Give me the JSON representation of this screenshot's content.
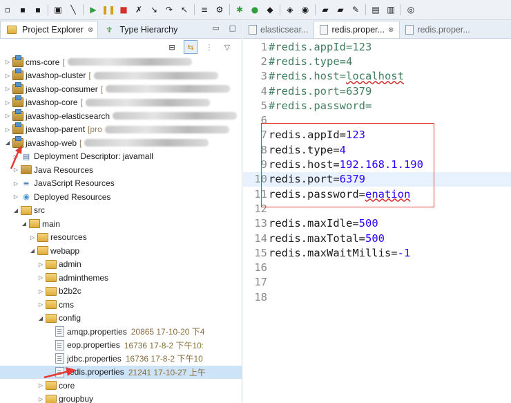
{
  "left_panel": {
    "tabs": [
      {
        "label": "Project Explorer",
        "close": "⊗",
        "icon": "project-explorer-icon"
      },
      {
        "label": "Type Hierarchy",
        "icon": "type-hierarchy-icon"
      }
    ],
    "tree": [
      {
        "label": "cms-core",
        "suffix": "[",
        "level": 0,
        "type": "project",
        "expanded": false
      },
      {
        "label": "javashop-cluster",
        "suffix": "[",
        "level": 0,
        "type": "project",
        "expanded": false
      },
      {
        "label": "javashop-consumer",
        "suffix": "[",
        "level": 0,
        "type": "project",
        "expanded": false
      },
      {
        "label": "javashop-core",
        "suffix": "[",
        "level": 0,
        "type": "project",
        "expanded": false
      },
      {
        "label": "javashop-elasticsearch",
        "suffix": "",
        "level": 0,
        "type": "project",
        "expanded": false
      },
      {
        "label": "javashop-parent",
        "suffix": "[pro",
        "level": 0,
        "type": "project",
        "expanded": false
      },
      {
        "label": "javashop-web",
        "suffix": "[",
        "level": 0,
        "type": "project",
        "expanded": true
      },
      {
        "label": "Deployment Descriptor: javamall",
        "level": 1,
        "type": "descriptor",
        "expanded": false
      },
      {
        "label": "Java Resources",
        "level": 1,
        "type": "java",
        "expanded": false
      },
      {
        "label": "JavaScript Resources",
        "level": 1,
        "type": "js",
        "expanded": false
      },
      {
        "label": "Deployed Resources",
        "level": 1,
        "type": "deployed",
        "expanded": false
      },
      {
        "label": "src",
        "level": 1,
        "type": "folder",
        "expanded": true
      },
      {
        "label": "main",
        "level": 2,
        "type": "folder",
        "expanded": true
      },
      {
        "label": "resources",
        "level": 3,
        "type": "folder",
        "expanded": false
      },
      {
        "label": "webapp",
        "level": 3,
        "type": "folder",
        "expanded": true
      },
      {
        "label": "admin",
        "level": 4,
        "type": "folder",
        "expanded": false
      },
      {
        "label": "adminthemes",
        "level": 4,
        "type": "folder",
        "expanded": false
      },
      {
        "label": "b2b2c",
        "level": 4,
        "type": "folder",
        "expanded": false
      },
      {
        "label": "cms",
        "level": 4,
        "type": "folder",
        "expanded": false
      },
      {
        "label": "config",
        "level": 4,
        "type": "folder",
        "expanded": true
      },
      {
        "label": "amqp.properties",
        "meta": "20865  17-10-20 下4",
        "level": 5,
        "type": "file"
      },
      {
        "label": "eop.properties",
        "meta": "16736  17-8-2 下午10:",
        "level": 5,
        "type": "file"
      },
      {
        "label": "jdbc.properties",
        "meta": "16736  17-8-2 下午10",
        "level": 5,
        "type": "file"
      },
      {
        "label": "redis.properties",
        "meta": "21241  17-10-27 上午",
        "level": 5,
        "type": "file",
        "selected": true
      },
      {
        "label": "core",
        "level": 4,
        "type": "folder",
        "expanded": false
      },
      {
        "label": "groupbuy",
        "level": 4,
        "type": "folder",
        "expanded": false
      }
    ]
  },
  "editor": {
    "tabs": [
      {
        "label": "elasticsear...",
        "active": false
      },
      {
        "label": "redis.proper...",
        "active": true,
        "close": "⊗"
      },
      {
        "label": "redis.proper...",
        "active": false
      }
    ],
    "lines": [
      {
        "num": "1",
        "key": "#redis.appId=",
        "val": "123",
        "comment": true
      },
      {
        "num": "2",
        "key": "#redis.type=",
        "val": "4",
        "comment": true
      },
      {
        "num": "3",
        "key": "#redis.host=",
        "val": "localhost",
        "comment": true,
        "underline": true
      },
      {
        "num": "4",
        "key": "#redis.port=",
        "val": "6379",
        "comment": true
      },
      {
        "num": "5",
        "key": "#redis.password=",
        "val": "",
        "comment": true
      },
      {
        "num": "6",
        "key": "",
        "val": ""
      },
      {
        "num": "7",
        "key": "redis.appId=",
        "val": "123"
      },
      {
        "num": "8",
        "key": "redis.type=",
        "val": "4"
      },
      {
        "num": "9",
        "key": "redis.host=",
        "val": "192.168.1.190"
      },
      {
        "num": "10",
        "key": "redis.port=",
        "val": "6379",
        "current": true
      },
      {
        "num": "11",
        "key": "redis.password=",
        "val": "enation",
        "underline": true
      },
      {
        "num": "12",
        "key": "",
        "val": ""
      },
      {
        "num": "13",
        "key": "redis.maxIdle=",
        "val": "500"
      },
      {
        "num": "14",
        "key": "redis.maxTotal=",
        "val": "500"
      },
      {
        "num": "15",
        "key": "redis.maxWaitMillis=",
        "val": "-1"
      },
      {
        "num": "16",
        "key": "",
        "val": ""
      },
      {
        "num": "17",
        "key": "",
        "val": ""
      },
      {
        "num": "18",
        "key": "",
        "val": ""
      }
    ]
  },
  "colors": {
    "accent_red": "#e53935",
    "value_blue": "#2a00ff",
    "comment_green": "#3f7f5f"
  }
}
